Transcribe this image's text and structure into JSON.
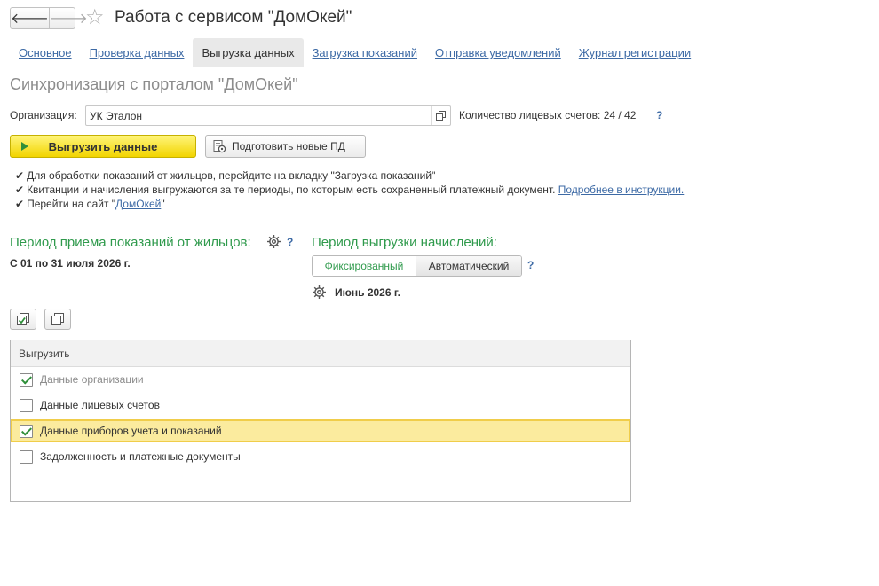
{
  "window": {
    "title": "Работа с сервисом \"ДомОкей\"",
    "back_glyph": "🡐",
    "forward_glyph": "🡒",
    "star_glyph": "☆"
  },
  "tabs": [
    {
      "label": "Основное",
      "active": false
    },
    {
      "label": "Проверка данных",
      "active": false
    },
    {
      "label": "Выгрузка данных",
      "active": true
    },
    {
      "label": "Загрузка показаний",
      "active": false
    },
    {
      "label": "Отправка уведомлений",
      "active": false
    },
    {
      "label": "Журнал регистрации",
      "active": false
    }
  ],
  "section_title": "Синхронизация с порталом \"ДомОкей\"",
  "organization": {
    "label": "Организация:",
    "value": "УК Эталон",
    "accounts_text": "Количество лицевых счетов: 24 / 42",
    "help": "?"
  },
  "buttons": {
    "upload_label": "Выгрузить данные",
    "prepare_label": "Подготовить новые ПД"
  },
  "notes": {
    "check_glyph": "✔",
    "line1": "Для обработки показаний от жильцов, перейдите на вкладку \"Загрузка показаний\"",
    "line2_text": "Квитанции и начисления выгружаются за те периоды, по которым есть сохраненный платежный документ.",
    "line2_link": "Подробнее в инструкции.",
    "line3_prefix": "Перейти на сайт \"",
    "line3_link": "ДомОкей",
    "line3_suffix": "\""
  },
  "period_readings": {
    "title": "Период приема показаний от жильцов:",
    "value": "С 01 по 31 июля 2026 г.",
    "help": "?"
  },
  "period_charges": {
    "title": "Период выгрузки начислений:",
    "options": [
      "Фиксированный",
      "Автоматический"
    ],
    "selected": "Фиксированный",
    "value": "Июнь 2026 г.",
    "help": "?"
  },
  "list": {
    "header": "Выгрузить",
    "items": [
      {
        "label": "Данные организации",
        "checked": true,
        "disabled": true
      },
      {
        "label": "Данные лицевых счетов",
        "checked": false,
        "disabled": false
      },
      {
        "label": "Данные приборов учета и показаний",
        "checked": true,
        "disabled": false,
        "selected": true
      },
      {
        "label": "Задолженность и платежные документы",
        "checked": false,
        "disabled": false
      }
    ]
  },
  "colors": {
    "accent_green": "#2f9a4c",
    "link_blue": "#3d6aa5",
    "upload_yellow": "#f2d400",
    "selection": "#fbeb9e"
  }
}
